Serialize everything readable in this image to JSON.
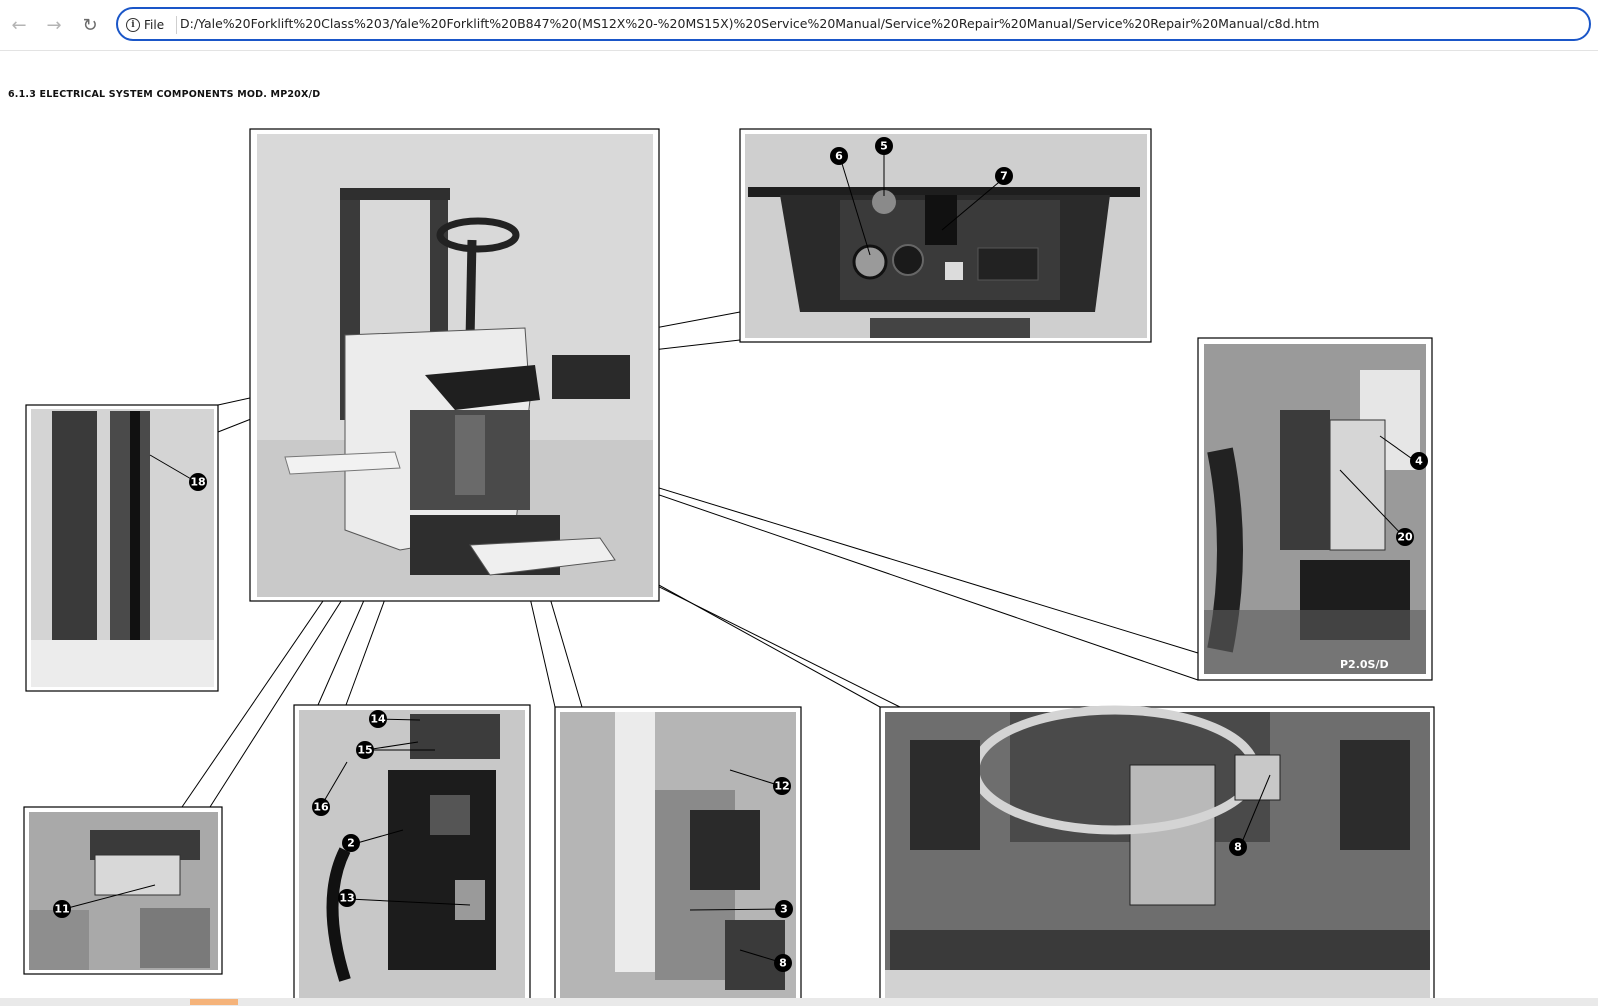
{
  "browser": {
    "back_icon": "arrow-left-icon",
    "forward_icon": "arrow-right-icon",
    "reload_icon": "reload-icon",
    "site_info_label": "File",
    "url": "D:/Yale%20Forklift%20Class%203/Yale%20Forklift%20B847%20(MS12X%20-%20MS15X)%20Service%20Manual/Service%20Repair%20Manual/Service%20Repair%20Manual/c8d.htm",
    "accent_color": "#1a56c8"
  },
  "page": {
    "heading": "6.1.3 ELECTRICAL SYSTEM COMPONENTS MOD. MP20X/D",
    "photo_label": "P2.0S/D",
    "callouts": {
      "c2": "2",
      "c3": "3",
      "c4": "4",
      "c5": "5",
      "c6": "6",
      "c7": "7",
      "c8a": "8",
      "c8b": "8",
      "c11": "11",
      "c12": "12",
      "c13": "13",
      "c14": "14",
      "c15": "15",
      "c16": "16",
      "c18": "18",
      "c20": "20"
    }
  }
}
